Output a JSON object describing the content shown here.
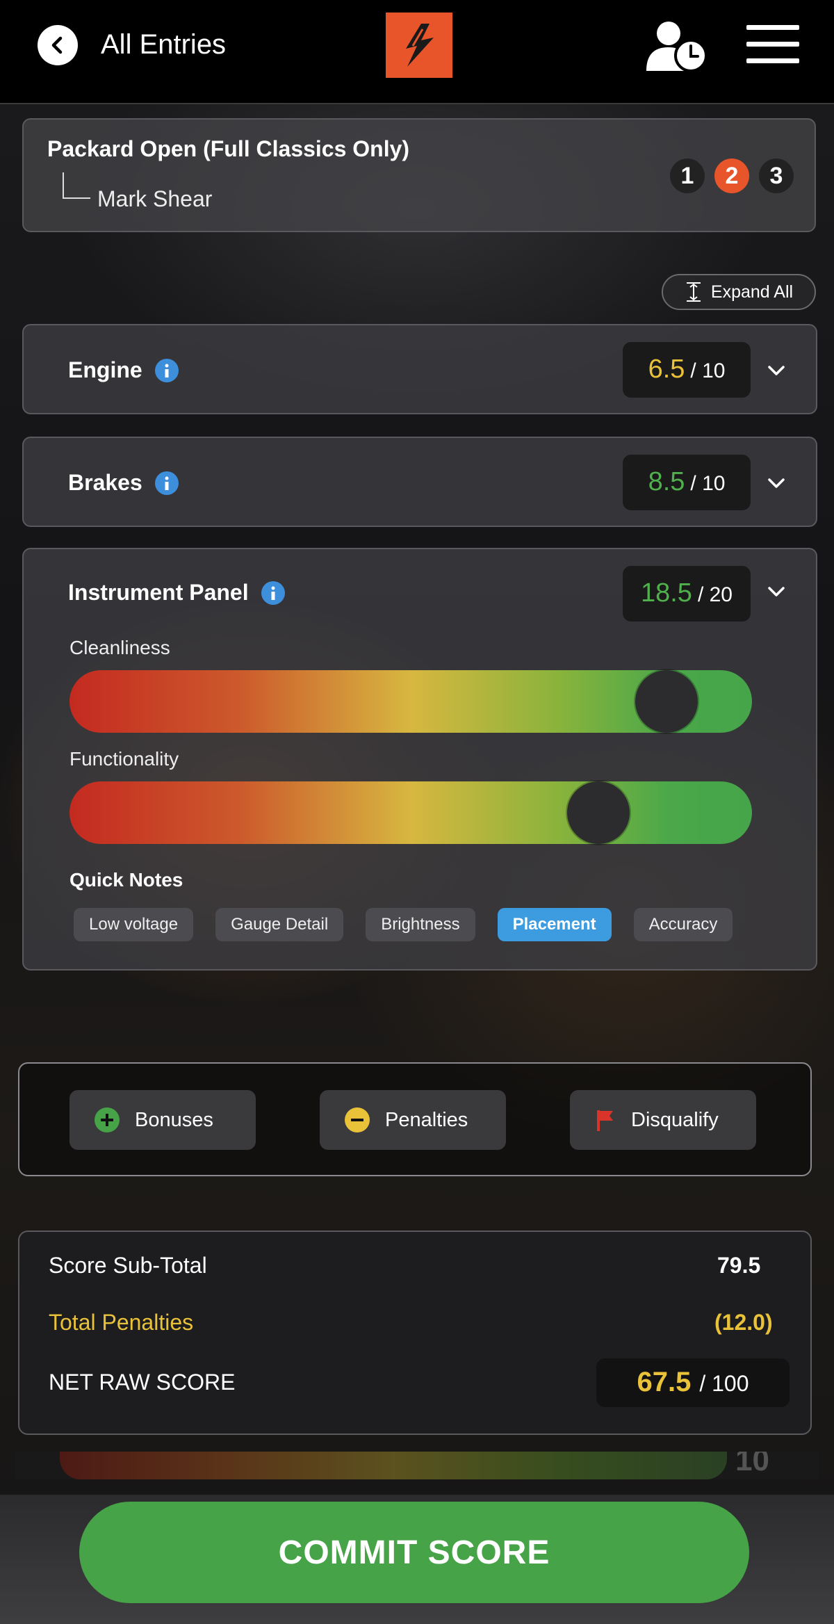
{
  "header": {
    "back_title": "All Entries",
    "icons": [
      "chevron-left-icon",
      "lightning-logo",
      "user-clock-icon",
      "hamburger-menu-icon"
    ]
  },
  "class_info": {
    "title": "Packard Open (Full Classics Only)",
    "judge": "Mark Shear",
    "steps": [
      "1",
      "2",
      "3"
    ],
    "active_step": "2"
  },
  "expand_all": {
    "label": "Expand All"
  },
  "categories": [
    {
      "name": "Engine",
      "score": "6.5",
      "max": "10",
      "score_color": "#e9c23a"
    },
    {
      "name": "Brakes",
      "score": "8.5",
      "max": "10",
      "score_color": "#4fb04c"
    },
    {
      "name": "Instrument Panel",
      "score": "18.5",
      "max": "20",
      "score_color": "#4fb04c",
      "sliders": [
        {
          "label": "Cleanliness",
          "level": 0.875
        },
        {
          "label": "Functionality",
          "level": 0.775
        }
      ],
      "quick_notes_title": "Quick Notes",
      "quick_notes": [
        {
          "label": "Low voltage",
          "selected": false
        },
        {
          "label": "Gauge Detail",
          "selected": false
        },
        {
          "label": "Brightness",
          "selected": false
        },
        {
          "label": "Placement",
          "selected": true
        },
        {
          "label": "Accuracy",
          "selected": false
        }
      ]
    }
  ],
  "actions": {
    "bonuses": "Bonuses",
    "penalties": "Penalties",
    "disqualify": "Disqualify"
  },
  "totals": {
    "subtotal_label": "Score Sub-Total",
    "subtotal_value": "79.5",
    "penalties_label": "Total Penalties",
    "penalties_value": "(12.0)",
    "net_label": "NET RAW SCORE",
    "net_value": "67.5",
    "net_max": "100"
  },
  "peek_value": "10",
  "commit": {
    "label": "COMMIT SCORE"
  },
  "colors": {
    "accent_orange": "#e9552b",
    "green": "#46a347",
    "yellow": "#e9c23a",
    "info_blue": "#3d8fdb",
    "chip_selected": "#3d9be0"
  }
}
